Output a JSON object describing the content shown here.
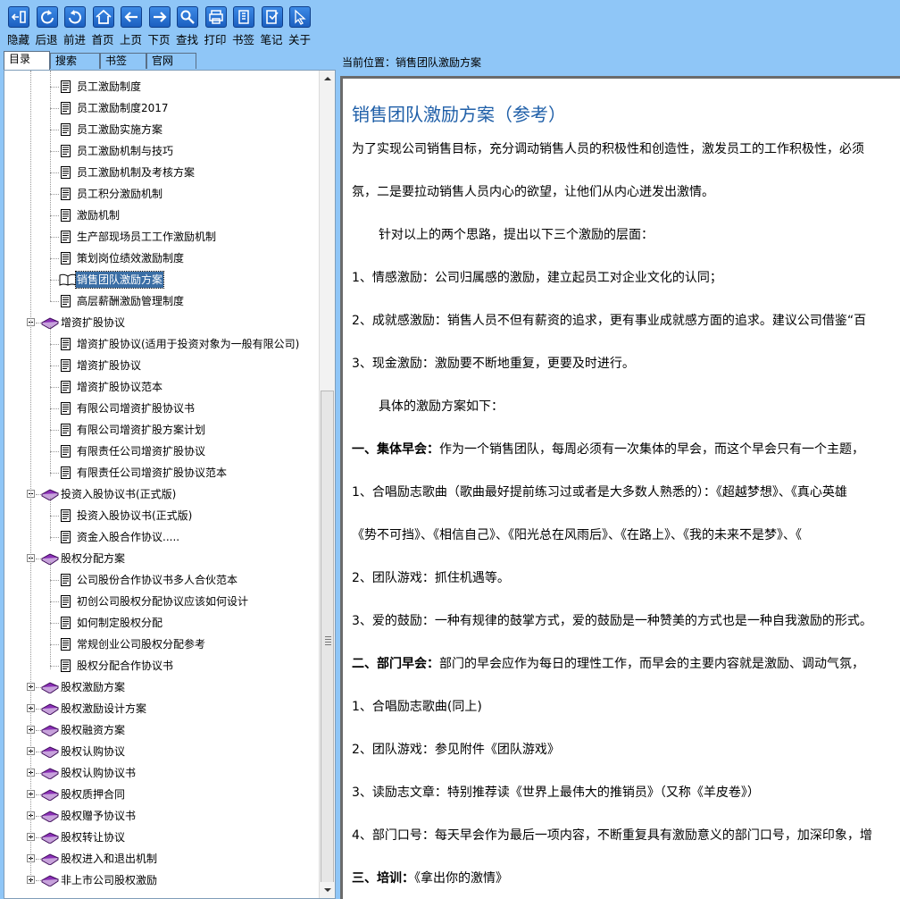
{
  "toolbar": {
    "buttons": [
      {
        "id": "hide",
        "label": "隐藏",
        "icon": "hide-panel-icon"
      },
      {
        "id": "back",
        "label": "后退",
        "icon": "back-arrow-icon"
      },
      {
        "id": "forward",
        "label": "前进",
        "icon": "forward-arrow-icon"
      },
      {
        "id": "home",
        "label": "首页",
        "icon": "home-icon"
      },
      {
        "id": "prev",
        "label": "上页",
        "icon": "left-arrow-icon"
      },
      {
        "id": "next",
        "label": "下页",
        "icon": "right-arrow-icon"
      },
      {
        "id": "find",
        "label": "查找",
        "icon": "search-icon"
      },
      {
        "id": "print",
        "label": "打印",
        "icon": "print-icon"
      },
      {
        "id": "bookmark",
        "label": "书签",
        "icon": "bookmark-icon"
      },
      {
        "id": "notes",
        "label": "笔记",
        "icon": "notes-icon"
      },
      {
        "id": "about",
        "label": "关于",
        "icon": "cursor-icon"
      }
    ]
  },
  "tabs": [
    "目录",
    "搜索",
    "书签",
    "官网"
  ],
  "tree": {
    "items": [
      {
        "label": "员工激励制度",
        "type": "doc"
      },
      {
        "label": "员工激励制度2017",
        "type": "doc"
      },
      {
        "label": "员工激励实施方案",
        "type": "doc"
      },
      {
        "label": "员工激励机制与技巧",
        "type": "doc"
      },
      {
        "label": "员工激励机制及考核方案",
        "type": "doc"
      },
      {
        "label": "员工积分激励机制",
        "type": "doc"
      },
      {
        "label": "激励机制",
        "type": "doc"
      },
      {
        "label": "生产部现场员工工作激励机制",
        "type": "doc"
      },
      {
        "label": "策划岗位绩效激励制度",
        "type": "doc"
      },
      {
        "label": "销售团队激励方案",
        "type": "open",
        "selected": true
      },
      {
        "label": "高层薪酬激励管理制度",
        "type": "doc"
      },
      {
        "label": "增资扩股协议",
        "type": "folder",
        "expanded": true
      },
      {
        "label": "增资扩股协议(适用于投资对象为一般有限公司)",
        "type": "doc"
      },
      {
        "label": "增资扩股协议",
        "type": "doc"
      },
      {
        "label": "增资扩股协议范本",
        "type": "doc"
      },
      {
        "label": "有限公司增资扩股协议书",
        "type": "doc"
      },
      {
        "label": "有限公司增资扩股方案计划",
        "type": "doc"
      },
      {
        "label": "有限责任公司增资扩股协议",
        "type": "doc"
      },
      {
        "label": "有限责任公司增资扩股协议范本",
        "type": "doc"
      },
      {
        "label": "投资入股协议书(正式版)",
        "type": "folder",
        "expanded": true
      },
      {
        "label": "投资入股协议书(正式版)",
        "type": "doc"
      },
      {
        "label": "资金入股合作协议.....",
        "type": "doc"
      },
      {
        "label": "股权分配方案",
        "type": "folder",
        "expanded": true
      },
      {
        "label": "公司股份合作协议书多人合伙范本",
        "type": "doc"
      },
      {
        "label": "初创公司股权分配协议应该如何设计",
        "type": "doc"
      },
      {
        "label": "如何制定股权分配",
        "type": "doc"
      },
      {
        "label": "常规创业公司股权分配参考",
        "type": "doc"
      },
      {
        "label": "股权分配合作协议书",
        "type": "doc"
      },
      {
        "label": "股权激励方案",
        "type": "folder",
        "expanded": false
      },
      {
        "label": "股权激励设计方案",
        "type": "folder",
        "expanded": false
      },
      {
        "label": "股权融资方案",
        "type": "folder",
        "expanded": false
      },
      {
        "label": "股权认购协议",
        "type": "folder",
        "expanded": false
      },
      {
        "label": "股权认购协议书",
        "type": "folder",
        "expanded": false
      },
      {
        "label": "股权质押合同",
        "type": "folder",
        "expanded": false
      },
      {
        "label": "股权赠予协议书",
        "type": "folder",
        "expanded": false
      },
      {
        "label": "股权转让协议",
        "type": "folder",
        "expanded": false
      },
      {
        "label": "股权进入和退出机制",
        "type": "folder",
        "expanded": false
      },
      {
        "label": "非上市公司股权激励",
        "type": "folder",
        "expanded": false
      }
    ]
  },
  "breadcrumb": "当前位置：销售团队激励方案",
  "article": {
    "title": "销售团队激励方案（参考）",
    "paragraphs": [
      {
        "text": "为了实现公司销售目标，充分调动销售人员的积极性和创造性，激发员工的工作积极性，必须"
      },
      {
        "text": "氛，二是要拉动销售人员内心的欲望，让他们从内心迸发出激情。"
      },
      {
        "text": "针对以上的两个思路，提出以下三个激励的层面：",
        "indent": true
      },
      {
        "text": "1、情感激励：公司归属感的激励，建立起员工对企业文化的认同；"
      },
      {
        "text": "2、成就感激励：销售人员不但有薪资的追求，更有事业成就感方面的追求。建议公司借鉴“百"
      },
      {
        "text": "3、现金激励：激励要不断地重复，更要及时进行。"
      },
      {
        "text": "具体的激励方案如下：",
        "indent": true
      },
      {
        "bold": "一、集体早会：",
        "text": "作为一个销售团队，每周必须有一次集体的早会，而这个早会只有一个主题，"
      },
      {
        "text": "1、合唱励志歌曲（歌曲最好提前练习过或者是大多数人熟悉的）：《超越梦想》、《真心英雄"
      },
      {
        "text": "《势不可挡》、《相信自己》、《阳光总在风雨后》、《在路上》、《我的未来不是梦》、《"
      },
      {
        "text": "2、团队游戏：抓住机遇等。"
      },
      {
        "text": "3、爱的鼓励：一种有规律的鼓掌方式，爱的鼓励是一种赞美的方式也是一种自我激励的形式。"
      },
      {
        "bold": "二、部门早会：",
        "text": "部门的早会应作为每日的理性工作，而早会的主要内容就是激励、调动气氛，"
      },
      {
        "text": "1、合唱励志歌曲(同上)"
      },
      {
        "text": "2、团队游戏：参见附件《团队游戏》"
      },
      {
        "text": "3、读励志文章：特别推荐读《世界上最伟大的推销员》（又称《羊皮卷》）"
      },
      {
        "text": "4、部门口号：每天早会作为最后一项内容，不断重复具有激励意义的部门口号，加深印象，增"
      },
      {
        "bold": "三、培训：",
        "text": "《拿出你的激情》"
      }
    ]
  }
}
